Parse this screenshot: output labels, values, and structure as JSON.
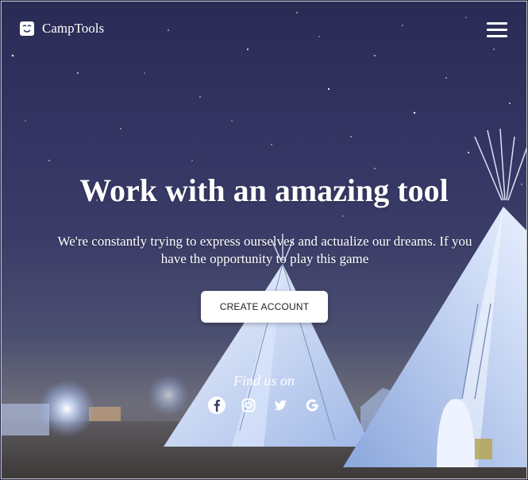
{
  "nav": {
    "brand": "CampTools",
    "logo_icon": "face-icon",
    "menu_icon": "hamburger-menu-icon"
  },
  "hero": {
    "title": "Work with an amazing tool",
    "description": "We're constantly trying to express ourselves and actualize our dreams. If you have the opportunity to play this game",
    "cta_label": "CREATE ACCOUNT"
  },
  "social": {
    "heading": "Find us on",
    "icons": [
      "facebook-icon",
      "instagram-icon",
      "twitter-icon",
      "google-icon"
    ]
  },
  "colors": {
    "text": "#ffffff",
    "button_bg": "#ffffff",
    "button_text": "#222222",
    "sky": "#2c2d52"
  }
}
